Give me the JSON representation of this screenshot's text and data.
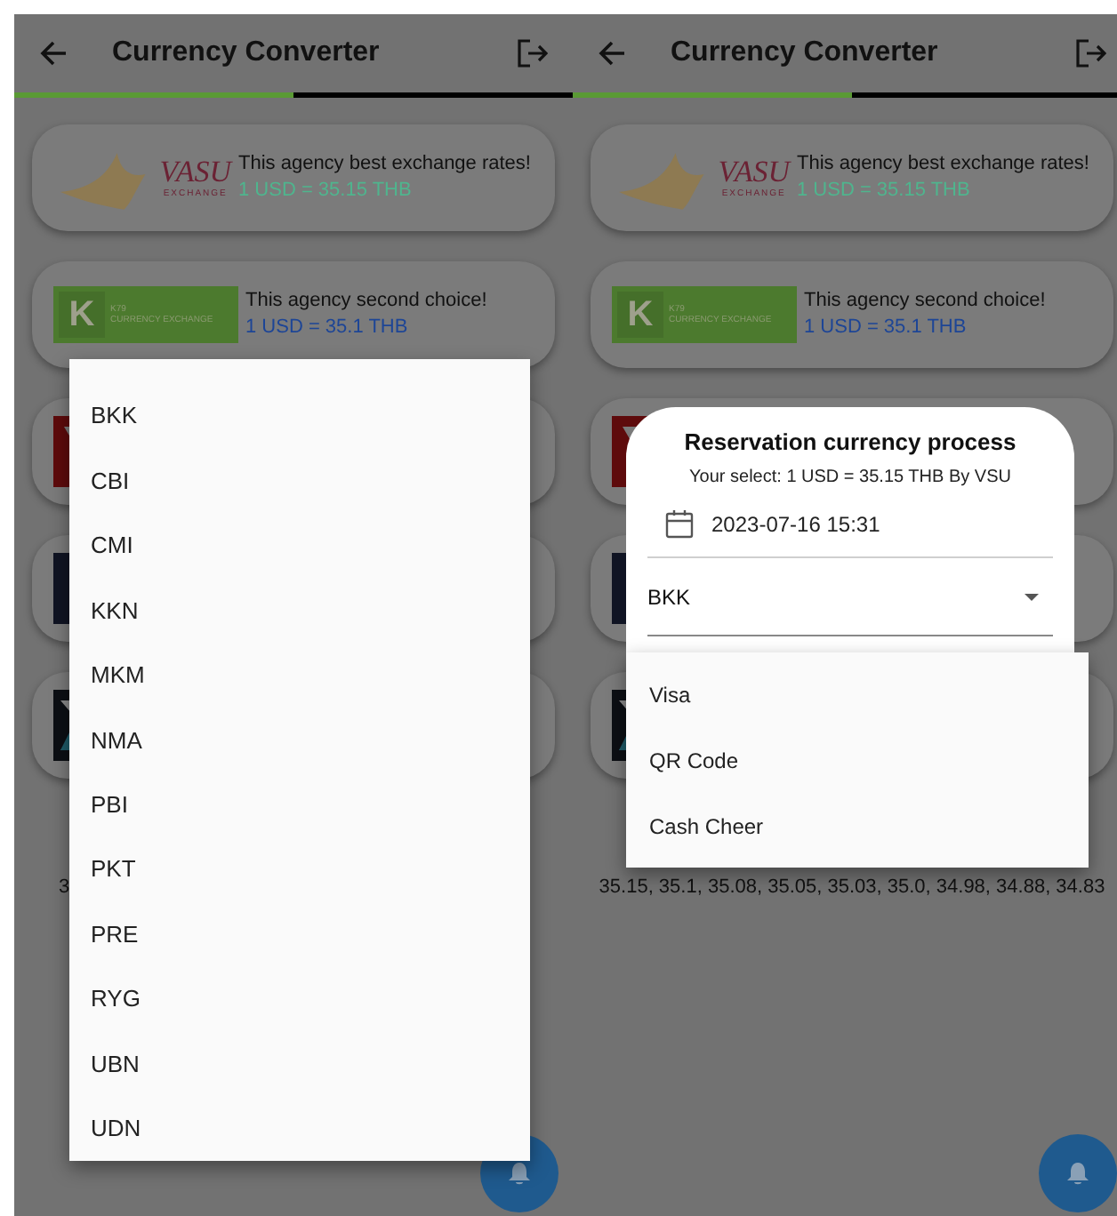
{
  "panels": [
    {
      "title": "Currency Converter",
      "tabs": [
        {
          "selected": true
        },
        {
          "selected": false
        }
      ],
      "agencies": [
        {
          "logo": {
            "kind": "bird",
            "texts": [
              "VASU",
              "EXCHANGE"
            ]
          },
          "headline": "This agency best exchange rates!",
          "rate": "1 USD = 35.15 THB",
          "color": "#4fb58e"
        },
        {
          "logo": {
            "kind": "k",
            "texts": [
              "K",
              "K79",
              "CURRENCY EXCHANGE"
            ]
          },
          "headline": "This agency second choice!",
          "rate": "1 USD = 35.1 THB",
          "color": "#1d4596"
        },
        {
          "logo": {
            "kind": "red"
          }
        },
        {
          "logo": {
            "kind": "navy"
          }
        },
        {
          "logo": {
            "kind": "chevron"
          }
        }
      ],
      "rates_text": "3",
      "overlay": {
        "kind": "menu",
        "items": [
          "BKK",
          "CBI",
          "CMI",
          "KKN",
          "MKM",
          "NMA",
          "PBI",
          "PKT",
          "PRE",
          "RYG",
          "UBN",
          "UDN"
        ]
      }
    },
    {
      "title": "Currency Converter",
      "tabs": [
        {
          "selected": true
        },
        {
          "selected": false
        }
      ],
      "agencies": [
        {
          "logo": {
            "kind": "bird",
            "texts": [
              "VASU",
              "EXCHANGE"
            ]
          },
          "headline": "This agency best exchange rates!",
          "rate": "1 USD = 35.15 THB",
          "color": "#4fb58e"
        },
        {
          "logo": {
            "kind": "k",
            "texts": [
              "K",
              "K79",
              "CURRENCY EXCHANGE"
            ]
          },
          "headline": "This agency second choice!",
          "rate": "1 USD = 35.1 THB",
          "color": "#1d4596"
        },
        {
          "logo": {
            "kind": "red"
          }
        },
        {
          "logo": {
            "kind": "navy"
          }
        },
        {
          "logo": {
            "kind": "chevron"
          }
        }
      ],
      "rates_text": "35.15, 35.1, 35.08, 35.05, 35.03, 35.0, 34.98, 34.88, 34.83",
      "overlay": {
        "kind": "dialog",
        "title": "Reservation currency process",
        "subtitle": "Your select: 1 USD = 35.15 THB By VSU",
        "date": "2023-07-16 15:31",
        "branch": "BKK",
        "items": [
          "Visa",
          "QR Code",
          "Cash Cheer"
        ]
      }
    }
  ]
}
